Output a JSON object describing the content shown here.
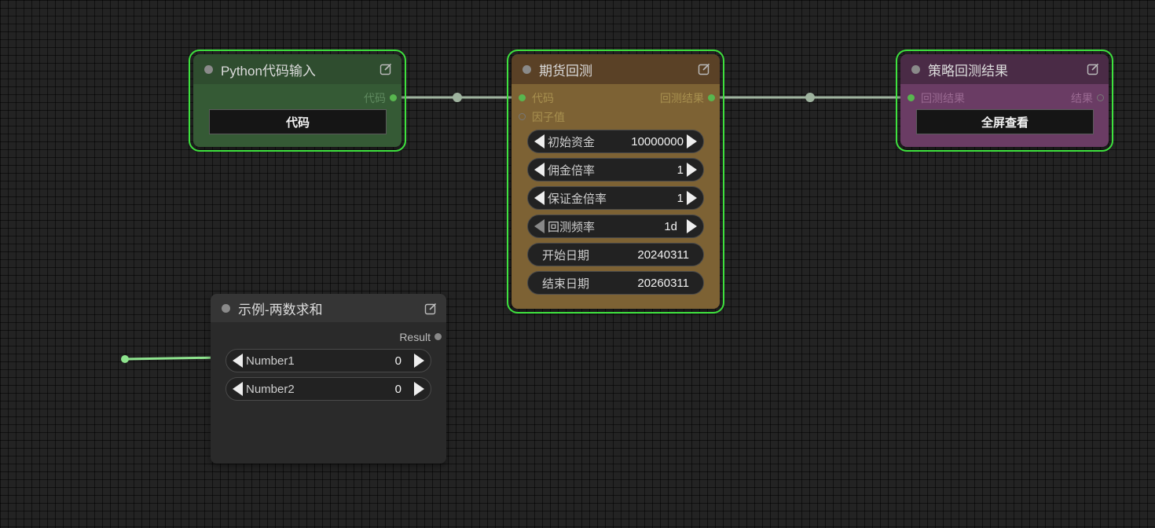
{
  "nodes": {
    "python_input": {
      "title": "Python代码输入",
      "output_label": "代码",
      "button_label": "代码"
    },
    "futures_backtest": {
      "title": "期货回测",
      "inputs": [
        "代码",
        "因子值"
      ],
      "output_label": "回测结果",
      "widgets": [
        {
          "label": "初始资金",
          "value": "10000000"
        },
        {
          "label": "佣金倍率",
          "value": "1"
        },
        {
          "label": "保证金倍率",
          "value": "1"
        },
        {
          "label": "回测频率",
          "value": "1d"
        },
        {
          "label": "开始日期",
          "value": "20240311"
        },
        {
          "label": "结束日期",
          "value": "20260311"
        }
      ]
    },
    "strategy_result": {
      "title": "策略回测结果",
      "input_label": "回测结果",
      "output_label": "结果",
      "button_label": "全屏查看"
    },
    "sum_example": {
      "title": "示例-两数求和",
      "output_label": "Result",
      "widgets": [
        {
          "label": "Number1",
          "value": "0"
        },
        {
          "label": "Number2",
          "value": "0"
        }
      ]
    }
  },
  "colors": {
    "python_title": "#2f4d2f",
    "python_body": "#355a35",
    "backtest_title": "#5a4126",
    "backtest_body": "#7d6234",
    "result_title": "#4a2b46",
    "result_body": "#6a3c64",
    "sum_title": "#353535",
    "sum_body": "#2a2a2a",
    "selection": "#3ee13e",
    "link": "#9fb39f"
  },
  "icons": {
    "node_status": "dot-icon",
    "edit": "edit-icon",
    "decrement": "triangle-left-icon",
    "increment": "triangle-right-icon"
  }
}
